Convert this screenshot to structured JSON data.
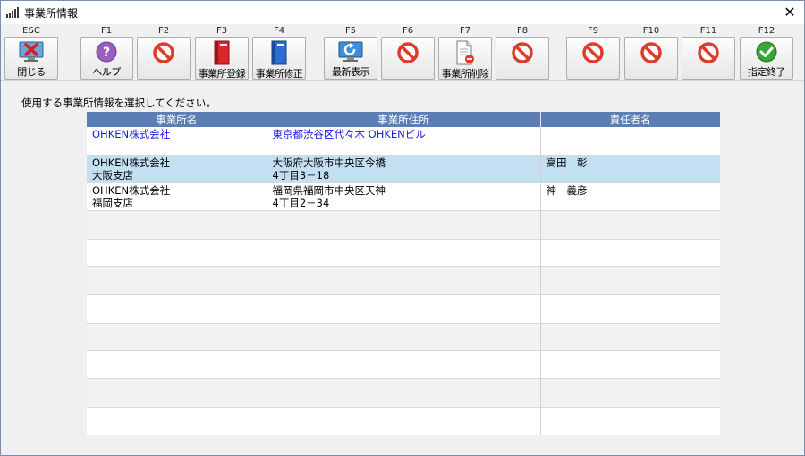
{
  "window": {
    "title": "事業所情報",
    "close_glyph": "✕"
  },
  "toolbar": {
    "buttons": [
      {
        "key": "ESC",
        "label": "閉じる",
        "icon": "close-monitor-icon"
      },
      {
        "key": "F1",
        "label": "ヘルプ",
        "icon": "help-icon"
      },
      {
        "key": "F2",
        "label": "",
        "icon": "disabled-icon"
      },
      {
        "key": "F3",
        "label": "事業所登録",
        "icon": "red-binder-icon"
      },
      {
        "key": "F4",
        "label": "事業所修正",
        "icon": "blue-binder-icon"
      },
      {
        "key": "F5",
        "label": "最新表示",
        "icon": "refresh-icon"
      },
      {
        "key": "F6",
        "label": "",
        "icon": "disabled-icon"
      },
      {
        "key": "F7",
        "label": "事業所削除",
        "icon": "delete-document-icon"
      },
      {
        "key": "F8",
        "label": "",
        "icon": "disabled-icon"
      },
      {
        "key": "F9",
        "label": "",
        "icon": "disabled-icon"
      },
      {
        "key": "F10",
        "label": "",
        "icon": "disabled-icon"
      },
      {
        "key": "F11",
        "label": "",
        "icon": "disabled-icon"
      },
      {
        "key": "F12",
        "label": "指定終了",
        "icon": "check-icon"
      }
    ]
  },
  "instruction": "使用する事業所情報を選択してください。",
  "table": {
    "headers": [
      "事業所名",
      "事業所住所",
      "責任者名"
    ],
    "rows": [
      {
        "name1": "OHKEN株式会社",
        "name2": "",
        "addr1": "東京都渋谷区代々木 OHKENビル",
        "addr2": "",
        "manager": ""
      },
      {
        "name1": "OHKEN株式会社",
        "name2": "大阪支店",
        "addr1": "大阪府大阪市中央区今橋",
        "addr2": "4丁目3－18",
        "manager": "高田　彰"
      },
      {
        "name1": "OHKEN株式会社",
        "name2": "福岡支店",
        "addr1": "福岡県福岡市中央区天神",
        "addr2": "4丁目2－34",
        "manager": "神　義彦"
      }
    ]
  },
  "colors": {
    "header_bg": "#5b7fb4",
    "selected_row": "#c3dff2",
    "link_text": "#1a1ae6"
  }
}
